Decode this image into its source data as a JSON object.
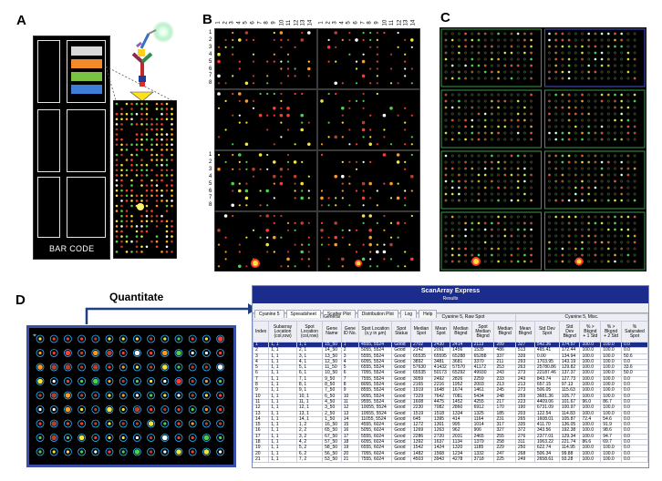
{
  "panels": {
    "a": "A",
    "b": "B",
    "c": "C",
    "d": "D"
  },
  "barcode_label": "BAR CODE",
  "quantitate_label": "Quantitate",
  "colors": {
    "accent_blue": "#1c2c8c",
    "arrow": "#1f3f7f",
    "slide_bg": "#000000",
    "box_green": "#3a9a4a",
    "box_blue": "#4455cc"
  },
  "reagent_colors": [
    "#d9d9d9",
    "#f28a2b",
    "#7cc242",
    "#3d7fd6"
  ],
  "icons": [
    "antibody-icon",
    "fluorescent-glow-icon"
  ],
  "b_col_numbers": [
    "1",
    "2",
    "3",
    "4",
    "5",
    "6",
    "7",
    "8",
    "9",
    "10",
    "11",
    "12",
    "13",
    "14"
  ],
  "b_row_numbers": [
    "1",
    "2",
    "3",
    "4",
    "5",
    "6",
    "7",
    "8"
  ],
  "sheet": {
    "title": "ScanArray Express",
    "subtitle": "Results",
    "tabs": [
      "Cyanine 5",
      "Spreadsheet",
      "Scatter Plot",
      "Distribution Plot",
      "Log",
      "Help"
    ],
    "groups": [
      {
        "label": "General",
        "span": 7
      },
      {
        "label": "Cyanine 5, Raw Spot",
        "span": 5
      },
      {
        "label": "Cyanine 5, Misc.",
        "span": 7
      }
    ],
    "columns": [
      "Index",
      "Subarray Location (col,row)",
      "Spot Location (col,row)",
      "Gene Name",
      "Gene ID No.",
      "Spot Location (x,y in µm)",
      "Spot Status",
      "Median Spot",
      "Mean Spot",
      "Median Bkgnd",
      "Spot Median Bkgnd",
      "Median Bkgnd",
      "Mean Bkgnd",
      "Std Dev Spot",
      "Std Dev Bkgnd",
      "% > Bkgnd + 1 Std",
      "% > Bkgnd + 2 Std",
      "% Saturated Spot"
    ],
    "rows": [
      [
        "1",
        "1, 1",
        "1, 1",
        "15_50",
        "1",
        "4555, 5524",
        "Good",
        "2702",
        "2430",
        "2414",
        "2113",
        "289",
        "327",
        "542.36",
        "174.57",
        "100.0",
        "100.0",
        "0.0"
      ],
      [
        "2",
        "1, 1",
        "2, 1",
        "14_50",
        "2",
        "5055, 5524",
        "Good",
        "2142",
        "2091",
        "1456",
        "1535",
        "486",
        "513",
        "465.41",
        "172.44",
        "100.0",
        "100.0",
        "0.0"
      ],
      [
        "3",
        "1, 1",
        "3, 1",
        "13_50",
        "3",
        "5555, 5524",
        "Good",
        "65535",
        "65595",
        "65288",
        "65288",
        "337",
        "339",
        "0.00",
        "134.94",
        "100.0",
        "100.0",
        "50.6"
      ],
      [
        "4",
        "1, 1",
        "4, 1",
        "12_50",
        "4",
        "6055, 5524",
        "Good",
        "3892",
        "3481",
        "3681",
        "3370",
        "211",
        "293",
        "1703.95",
        "143.19",
        "100.0",
        "100.0",
        "0.0"
      ],
      [
        "5",
        "1, 1",
        "5, 1",
        "11_50",
        "5",
        "6555, 5524",
        "Good",
        "57630",
        "41432",
        "57570",
        "41172",
        "253",
        "263",
        "25780.86",
        "129.82",
        "100.0",
        "100.0",
        "33.6"
      ],
      [
        "6",
        "1, 1",
        "6, 1",
        "10_50",
        "6",
        "7055, 5524",
        "Good",
        "65535",
        "50173",
        "65292",
        "49930",
        "243",
        "273",
        "22187.46",
        "137.37",
        "100.0",
        "100.0",
        "50.0"
      ],
      [
        "7",
        "1, 1",
        "7, 1",
        "9_50",
        "7",
        "7555, 5524",
        "Good",
        "3059",
        "2492",
        "2826",
        "2259",
        "233",
        "243",
        "843.74",
        "127.73",
        "100.0",
        "100.0",
        "0.0"
      ],
      [
        "8",
        "1, 1",
        "8, 1",
        "8_50",
        "8",
        "8055, 5524",
        "Good",
        "2165",
        "2216",
        "1952",
        "2003",
        "213",
        "213",
        "657.15",
        "97.13",
        "100.0",
        "100.0",
        "0.0"
      ],
      [
        "9",
        "1, 1",
        "9, 1",
        "7_50",
        "9",
        "8555, 5524",
        "Good",
        "1919",
        "1648",
        "1674",
        "1461",
        "245",
        "273",
        "506.05",
        "115.63",
        "100.0",
        "100.0",
        "0.0"
      ],
      [
        "10",
        "1, 1",
        "10, 1",
        "6_50",
        "10",
        "9055, 5524",
        "Good",
        "7329",
        "7642",
        "7081",
        "5434",
        "248",
        "259",
        "3681.36",
        "105.77",
        "100.0",
        "100.0",
        "0.0"
      ],
      [
        "11",
        "1, 1",
        "11, 1",
        "4_50",
        "11",
        "9555, 5524",
        "Good",
        "1608",
        "4475",
        "1452",
        "4255",
        "217",
        "223",
        "4409.06",
        "101.67",
        "96.0",
        "86.7",
        "0.0"
      ],
      [
        "12",
        "1, 1",
        "12, 1",
        "3_50",
        "12",
        "10055, 5524",
        "Good",
        "2230",
        "7082",
        "2860",
        "6912",
        "170",
        "190",
        "6731.09",
        "100.97",
        "100.0",
        "100.0",
        "0.0"
      ],
      [
        "13",
        "1, 1",
        "13, 1",
        "2_50",
        "13",
        "10555, 5524",
        "Good",
        "1519",
        "1518",
        "1334",
        "1325",
        "185",
        "203",
        "122.54",
        "114.83",
        "100.0",
        "100.0",
        "0.0"
      ],
      [
        "14",
        "1, 1",
        "14, 1",
        "1_50",
        "14",
        "11055, 5524",
        "Good",
        "645",
        "1395",
        "414",
        "1164",
        "231",
        "265",
        "1608.01",
        "105.87",
        "72.4",
        "54.6",
        "0.0"
      ],
      [
        "15",
        "1, 1",
        "1, 2",
        "16_50",
        "15",
        "4555, 6024",
        "Good",
        "1272",
        "1301",
        "995",
        "1014",
        "317",
        "335",
        "411.70",
        "136.05",
        "100.0",
        "91.9",
        "0.0"
      ],
      [
        "16",
        "1, 1",
        "2, 2",
        "65_50",
        "16",
        "5055, 6024",
        "Good",
        "1269",
        "1263",
        "962",
        "906",
        "327",
        "372",
        "343.56",
        "192.38",
        "100.0",
        "98.6",
        "0.0"
      ],
      [
        "17",
        "1, 1",
        "3, 2",
        "67_50",
        "17",
        "5555, 6024",
        "Good",
        "2286",
        "2720",
        "2031",
        "2465",
        "255",
        "276",
        "2377.01",
        "129.34",
        "100.0",
        "94.7",
        "0.0"
      ],
      [
        "18",
        "1, 1",
        "4, 2",
        "57_50",
        "18",
        "6055, 6024",
        "Good",
        "1392",
        "1637",
        "1134",
        "1379",
        "258",
        "311",
        "1063.22",
        "221.74",
        "86.6",
        "69.7",
        "0.0"
      ],
      [
        "19",
        "1, 1",
        "5, 2",
        "58_50",
        "19",
        "6555, 6024",
        "Good",
        "1542",
        "1424",
        "1320",
        "1185",
        "229",
        "250",
        "622.74",
        "114.95",
        "100.0",
        "100.0",
        "0.0"
      ],
      [
        "20",
        "1, 1",
        "6, 2",
        "56_50",
        "20",
        "7055, 6024",
        "Good",
        "1482",
        "1568",
        "1234",
        "1332",
        "247",
        "268",
        "506.34",
        "99.88",
        "100.0",
        "100.0",
        "0.0"
      ],
      [
        "21",
        "1, 1",
        "7, 2",
        "53_50",
        "21",
        "7555, 6024",
        "Good",
        "4503",
        "3943",
        "4278",
        "3718",
        "225",
        "249",
        "2658.61",
        "93.28",
        "100.0",
        "100.0",
        "0.0"
      ]
    ]
  }
}
